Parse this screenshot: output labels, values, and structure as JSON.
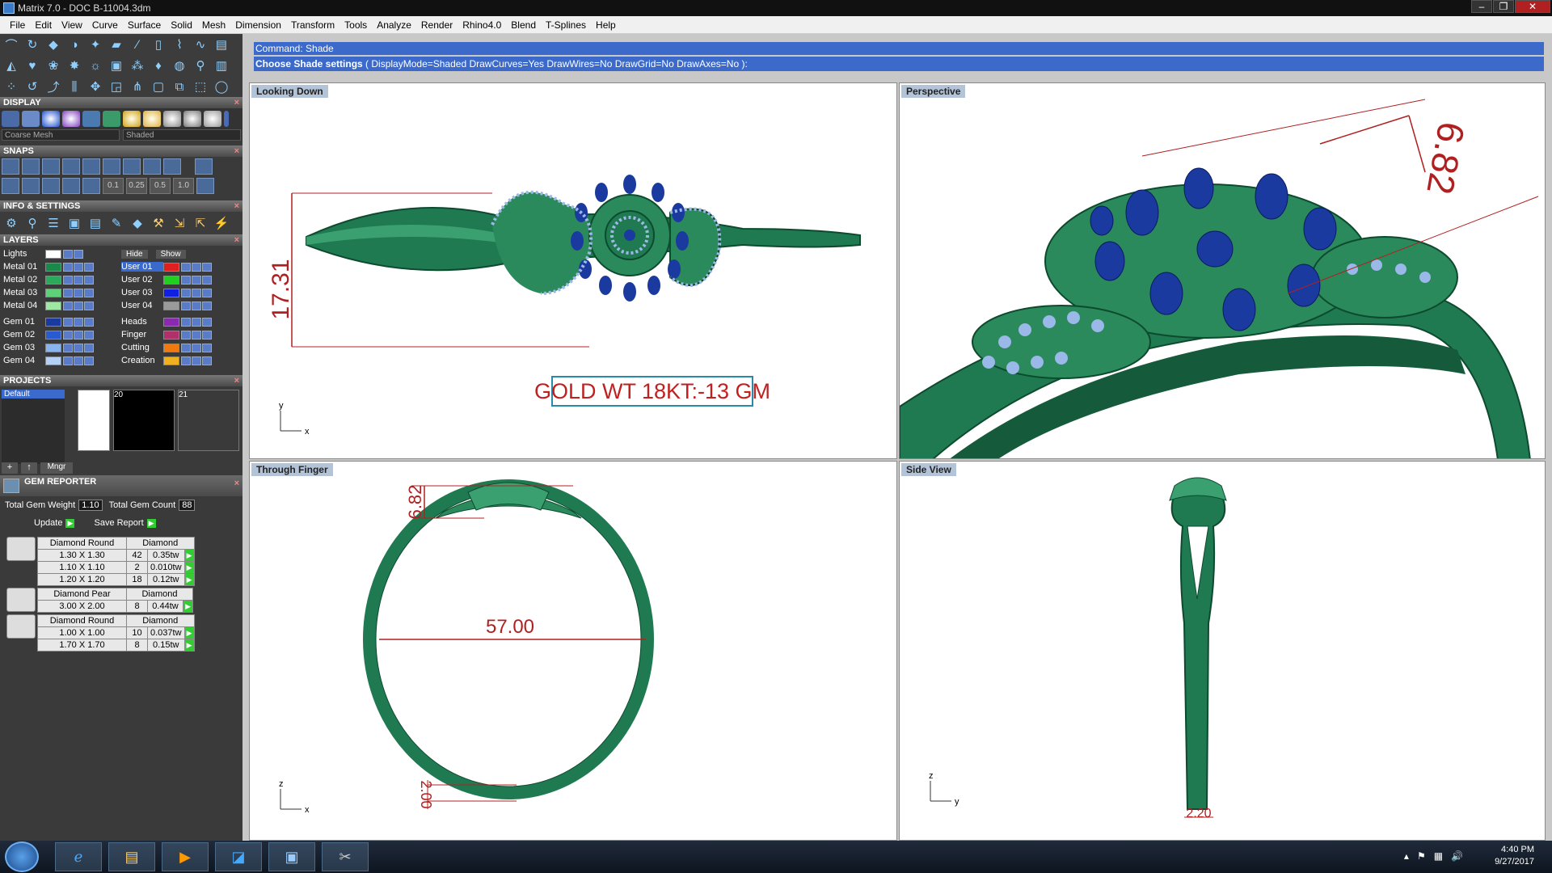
{
  "window": {
    "title": "Matrix 7.0 - DOC B-11004.3dm",
    "min": "–",
    "max": "❐",
    "close": "✕"
  },
  "menu": [
    "File",
    "Edit",
    "View",
    "Curve",
    "Surface",
    "Solid",
    "Mesh",
    "Dimension",
    "Transform",
    "Tools",
    "Analyze",
    "Render",
    "Rhino4.0",
    "Blend",
    "T-Splines",
    "Help"
  ],
  "panels": {
    "display": "DISPLAY",
    "display_mesh": "Coarse Mesh",
    "display_mode": "Shaded",
    "snaps": "SNAPS",
    "snap_values": [
      "0.1",
      "0.25",
      "0.5",
      "1.0"
    ],
    "info": "INFO & SETTINGS",
    "layers": "LAYERS",
    "lights": "Lights",
    "hide": "Hide",
    "show": "Show",
    "projects": "PROJECTS",
    "default_project": "Default",
    "thumb_20": "20",
    "thumb_21": "21",
    "mngr": "Mngr"
  },
  "layers_left": [
    {
      "name": "Metal 01",
      "color": "#1a8a4a"
    },
    {
      "name": "Metal 02",
      "color": "#2aaa5a"
    },
    {
      "name": "Metal 03",
      "color": "#5fd07a"
    },
    {
      "name": "Metal 04",
      "color": "#9ee8a4"
    },
    {
      "name": "Gem 01",
      "color": "#1a3aa0"
    },
    {
      "name": "Gem 02",
      "color": "#2a5ad0"
    },
    {
      "name": "Gem 03",
      "color": "#8ab4ee"
    },
    {
      "name": "Gem 04",
      "color": "#b4d0f4"
    }
  ],
  "layers_right": [
    {
      "name": "User 01",
      "color": "#e02020",
      "selected": true
    },
    {
      "name": "User 02",
      "color": "#20d020"
    },
    {
      "name": "User 03",
      "color": "#1020e0"
    },
    {
      "name": "User 04",
      "color": "#9a9a9a"
    },
    {
      "name": "Heads",
      "color": "#8a2ab0"
    },
    {
      "name": "Finger",
      "color": "#b0306a"
    },
    {
      "name": "Cutting",
      "color": "#f07a10"
    },
    {
      "name": "Creation",
      "color": "#f0b020"
    }
  ],
  "gem_reporter": {
    "title": "GEM REPORTER",
    "total_weight_label": "Total Gem Weight",
    "total_weight": "1.10",
    "total_count_label": "Total Gem Count",
    "total_count": "88",
    "update": "Update",
    "save": "Save Report",
    "groups": [
      {
        "shape": "Diamond Round",
        "material": "Diamond",
        "rows": [
          [
            "1.30 X 1.30",
            "42",
            "0.35tw"
          ],
          [
            "1.10 X 1.10",
            "2",
            "0.010tw"
          ],
          [
            "1.20 X 1.20",
            "18",
            "0.12tw"
          ]
        ]
      },
      {
        "shape": "Diamond Pear",
        "material": "Diamond",
        "rows": [
          [
            "3.00 X 2.00",
            "8",
            "0.44tw"
          ]
        ]
      },
      {
        "shape": "Diamond Round",
        "material": "Diamond",
        "rows": [
          [
            "1.00 X 1.00",
            "10",
            "0.037tw"
          ],
          [
            "1.70 X 1.70",
            "8",
            "0.15tw"
          ]
        ]
      }
    ]
  },
  "command": {
    "line1": "Command: Shade",
    "line2_bold": "Choose Shade settings",
    "line2_rest": "( DisplayMode=Shaded  DrawCurves=Yes  DrawWires=No  DrawGrid=No  DrawAxes=No ):"
  },
  "viewports": {
    "top": {
      "label": "Looking Down",
      "dim": "17.31",
      "axis_y": "y",
      "axis_x": "x",
      "note": "GOLD WT 18KT:-13 GM"
    },
    "persp": {
      "label": "Perspective",
      "dim": "6.82"
    },
    "front": {
      "label": "Through Finger",
      "dim_top": "6.82",
      "dim_mid": "57.00",
      "dim_bot": "2.00",
      "axis_z": "z",
      "axis_x": "x"
    },
    "side": {
      "label": "Side View",
      "dim": "2.20",
      "axis_z": "z",
      "axis_y": "y"
    }
  },
  "taskbar": {
    "time": "4:40 PM",
    "date": "9/27/2017"
  }
}
